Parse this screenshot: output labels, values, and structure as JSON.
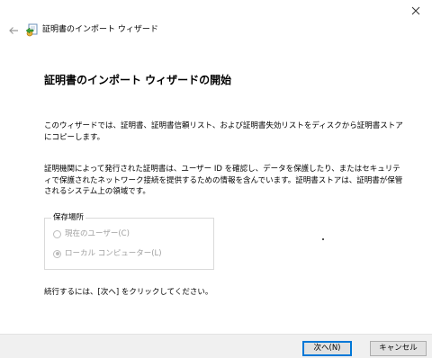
{
  "window": {
    "close_icon": "close-icon",
    "back_icon": "back-arrow-icon"
  },
  "header": {
    "icon": "certificate-wizard-icon",
    "title": "証明書のインポート ウィザード"
  },
  "main": {
    "heading": "証明書のインポート ウィザードの開始",
    "paragraph1": "このウィザードでは、証明書、証明書信頼リスト、および証明書失効リストをディスクから証明書ストアにコピーします。",
    "paragraph2": "証明機関によって発行された証明書は、ユーザー ID を確認し、データを保護したり、またはセキュリティで保護されたネットワーク接続を提供するための情報を含んでいます。証明書ストアは、証明書が保管されるシステム上の領域です。",
    "store_location": {
      "label": "保存場所",
      "options": [
        {
          "label": "現在のユーザー(C)",
          "selected": false,
          "enabled": false
        },
        {
          "label": "ローカル コンピューター(L)",
          "selected": true,
          "enabled": false
        }
      ]
    },
    "continue_text": "続行するには、[次へ] をクリックしてください。"
  },
  "footer": {
    "next_label": "次へ(N)",
    "cancel_label": "キャンセル"
  },
  "colors": {
    "accent": "#0078d7",
    "footer_bg": "#f0f0f0",
    "disabled_text": "#a0a0a0"
  }
}
